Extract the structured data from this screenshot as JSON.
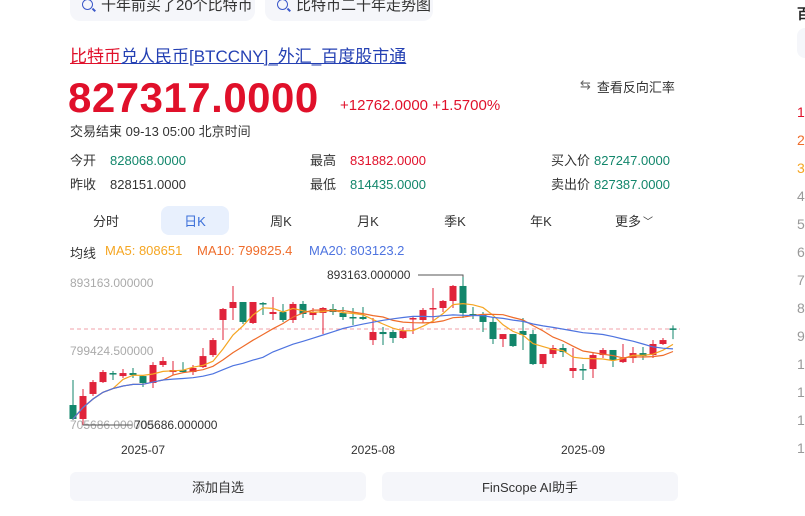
{
  "suggestions": [
    "十年前买了20个比特币",
    "比特币二十年走势图"
  ],
  "title": {
    "base": "比特币",
    "rest": "兑人民币[BTCCNY]_外汇_百度股市通"
  },
  "quote": {
    "price": "827317.0000",
    "change": "+12762.0000",
    "change_pct": "+1.5700%",
    "reverse_label": "查看反向汇率",
    "status": "交易结束 09-13 05:00 北京时间"
  },
  "stats": {
    "open": {
      "label": "今开",
      "value": "828068.0000"
    },
    "prev_close": {
      "label": "昨收",
      "value": "828151.0000"
    },
    "high": {
      "label": "最高",
      "value": "831882.0000"
    },
    "low": {
      "label": "最低",
      "value": "814435.0000"
    },
    "bid": {
      "label": "买入价",
      "value": "827247.0000"
    },
    "ask": {
      "label": "卖出价",
      "value": "827387.0000"
    }
  },
  "tabs": [
    {
      "label": "分时"
    },
    {
      "label": "日K",
      "selected": true
    },
    {
      "label": "周K"
    },
    {
      "label": "月K"
    },
    {
      "label": "季K"
    },
    {
      "label": "年K"
    },
    {
      "label": "更多"
    }
  ],
  "ma": {
    "label": "均线",
    "ma5": "MA5: 808651",
    "ma10": "MA10: 799825.4",
    "ma20": "MA20: 803123.2"
  },
  "colors": {
    "up": "#e0233a",
    "down": "#12866b",
    "ma5": "#f5a623",
    "ma10": "#ef6c2a",
    "ma20": "#4e74e0"
  },
  "chart_data": {
    "type": "candlestick",
    "y_ticks": [
      "893163.000000",
      "799424.500000",
      "705686.000000"
    ],
    "ylim": [
      705686,
      893163
    ],
    "max_label": "893163.000000",
    "min_label": "705686.000000",
    "x_ticks": [
      "2025-07",
      "2025-08",
      "2025-09"
    ],
    "last_price": 827317,
    "candles_ohlc": [
      [
        731000,
        762700,
        712000,
        713300
      ],
      [
        713300,
        751300,
        705686,
        742400
      ],
      [
        745000,
        762700,
        742400,
        760100
      ],
      [
        760100,
        775300,
        758900,
        772800
      ],
      [
        771500,
        774100,
        762700,
        770300
      ],
      [
        767700,
        776600,
        765200,
        771500
      ],
      [
        771500,
        777900,
        765200,
        769000
      ],
      [
        767700,
        769000,
        753800,
        758900
      ],
      [
        758900,
        785400,
        752600,
        781700
      ],
      [
        781700,
        791800,
        779100,
        786700
      ],
      [
        772800,
        786700,
        769000,
        775300
      ],
      [
        775300,
        785400,
        771500,
        772800
      ],
      [
        772800,
        781700,
        769000,
        777900
      ],
      [
        779100,
        803200,
        777900,
        793000
      ],
      [
        794300,
        815900,
        791800,
        813300
      ],
      [
        838700,
        853900,
        813300,
        852600
      ],
      [
        853900,
        881800,
        838700,
        861500
      ],
      [
        861500,
        861500,
        833600,
        836200
      ],
      [
        834900,
        861500,
        833600,
        861500
      ],
      [
        860200,
        861500,
        845000,
        859000
      ],
      [
        846300,
        867800,
        838700,
        848800
      ],
      [
        848800,
        859000,
        836200,
        838700
      ],
      [
        838700,
        861500,
        834900,
        859000
      ],
      [
        859000,
        862800,
        841200,
        846300
      ],
      [
        845000,
        853900,
        838700,
        848800
      ],
      [
        847600,
        855200,
        820900,
        853900
      ],
      [
        852600,
        859000,
        845000,
        848800
      ],
      [
        847600,
        855200,
        838700,
        842500
      ],
      [
        842500,
        853900,
        832300,
        841200
      ],
      [
        842500,
        855200,
        838700,
        840000
      ],
      [
        813300,
        841200,
        807000,
        823500
      ],
      [
        823500,
        829800,
        807000,
        820900
      ],
      [
        823500,
        826000,
        809600,
        815900
      ],
      [
        815900,
        829800,
        814600,
        824800
      ],
      [
        840000,
        842500,
        820900,
        841200
      ],
      [
        838700,
        853900,
        834900,
        851400
      ],
      [
        852600,
        879200,
        834900,
        853900
      ],
      [
        853900,
        864000,
        848800,
        862800
      ],
      [
        862800,
        883000,
        853900,
        881800
      ],
      [
        881800,
        893163,
        841200,
        847600
      ],
      [
        846300,
        855200,
        840000,
        843800
      ],
      [
        845000,
        848800,
        823500,
        836200
      ],
      [
        836200,
        841200,
        808300,
        814600
      ],
      [
        814600,
        820900,
        804500,
        820900
      ],
      [
        820900,
        820900,
        804500,
        805700
      ],
      [
        824800,
        841200,
        800700,
        819700
      ],
      [
        820900,
        826000,
        781700,
        782900
      ],
      [
        782900,
        795600,
        777900,
        795600
      ],
      [
        795600,
        807000,
        790500,
        803200
      ],
      [
        803200,
        808300,
        791800,
        798100
      ],
      [
        774100,
        803200,
        765200,
        777900
      ],
      [
        776600,
        782900,
        762700,
        775300
      ],
      [
        776600,
        796800,
        765200,
        794300
      ],
      [
        794300,
        803200,
        790500,
        800700
      ],
      [
        800700,
        800700,
        779100,
        788000
      ],
      [
        785400,
        808300,
        784200,
        790500
      ],
      [
        790500,
        804500,
        784200,
        796800
      ],
      [
        796800,
        804500,
        788000,
        793000
      ],
      [
        794300,
        813300,
        790500,
        808300
      ],
      [
        808300,
        815900,
        807000,
        813300
      ],
      [
        828068,
        831882,
        814435,
        827317
      ]
    ]
  },
  "actions": {
    "watchlist": "添加自选",
    "ai": "FinScope AI助手"
  },
  "sidebar": {
    "header": "百",
    "ranks": [
      "1",
      "2",
      "3",
      "4",
      "5",
      "6",
      "7",
      "8",
      "9",
      "1",
      "1",
      "1",
      "1"
    ]
  }
}
